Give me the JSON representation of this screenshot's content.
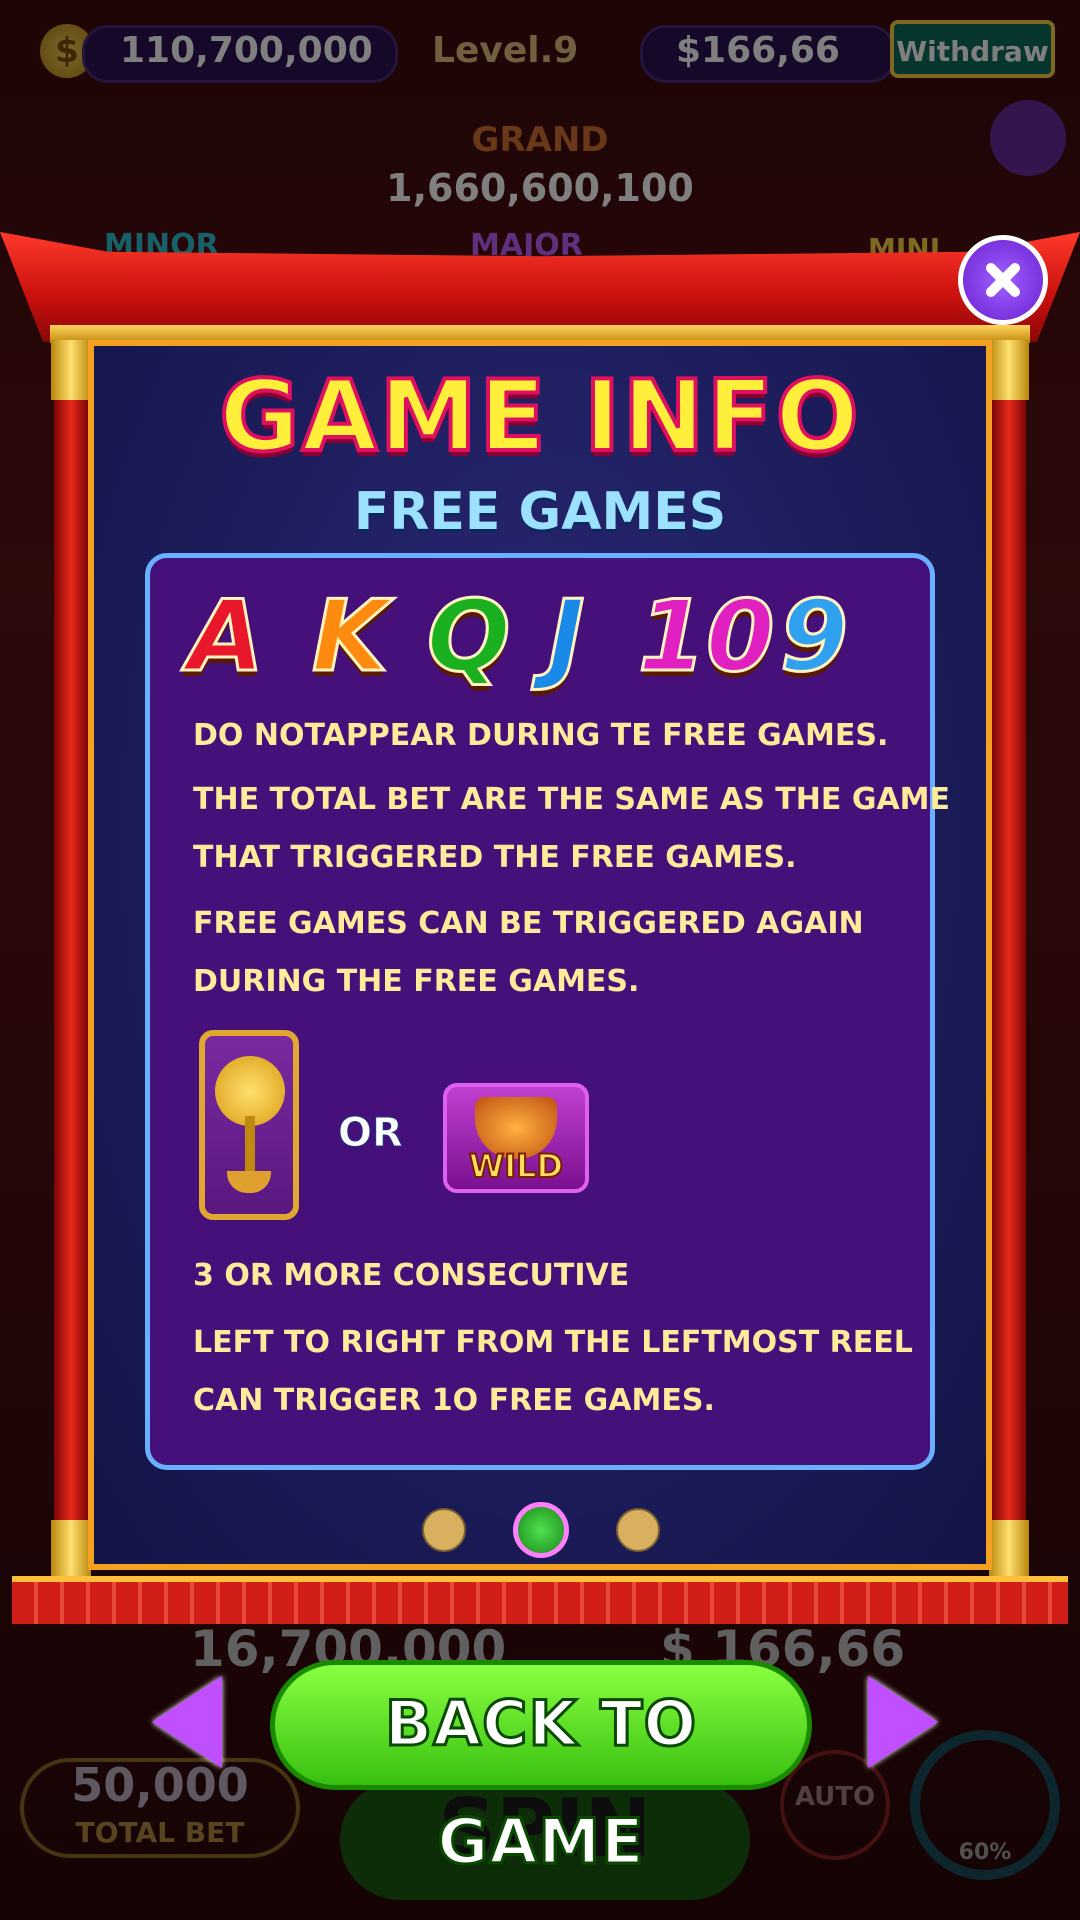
{
  "hud": {
    "balance": "110,700,000",
    "level": "Level.9",
    "cash": "$166,66",
    "withdraw_label": "Withdraw"
  },
  "jackpots": {
    "grand_label": "GRAND",
    "grand_value": "1,660,600,100",
    "minor_label": "MINOR",
    "major_label": "MAJOR",
    "mini_label": "MINI"
  },
  "bottom_bar": {
    "win_value": "16,700,000",
    "cash_value": "$ 166,66",
    "total_bet": "50,000",
    "total_bet_label": "TOTAL BET",
    "spin_label": "SPIN",
    "auto_label": "AUTO",
    "chest_percent": "60%"
  },
  "modal": {
    "title": "GAME INFO",
    "subtitle": "FREE GAMES",
    "symbols": [
      "A",
      "K",
      "Q",
      "J",
      "10",
      "9"
    ],
    "symbol_colors": [
      "#e8182a",
      "#ff8a10",
      "#1ab020",
      "#1a8ae8",
      "#e020c0",
      "#30a0f0"
    ],
    "lines": [
      "DO NOTAPPEAR DURING TE FREE GAMES.",
      "THE TOTAL BET ARE THE SAME AS THE GAME",
      "THAT TRIGGERED THE FREE GAMES.",
      "FREE GAMES CAN BE TRIGGERED AGAIN",
      "DURING THE FREE GAMES.",
      "3 OR MORE CONSECUTIVE",
      "LEFT TO RIGHT FROM THE LEFTMOST REEL",
      "CAN TRIGGER 1O FREE GAMES."
    ],
    "or_label": "OR",
    "wild_label": "WILD",
    "page_current": 2,
    "page_total": 3,
    "back_button": "BACK TO GAME"
  }
}
